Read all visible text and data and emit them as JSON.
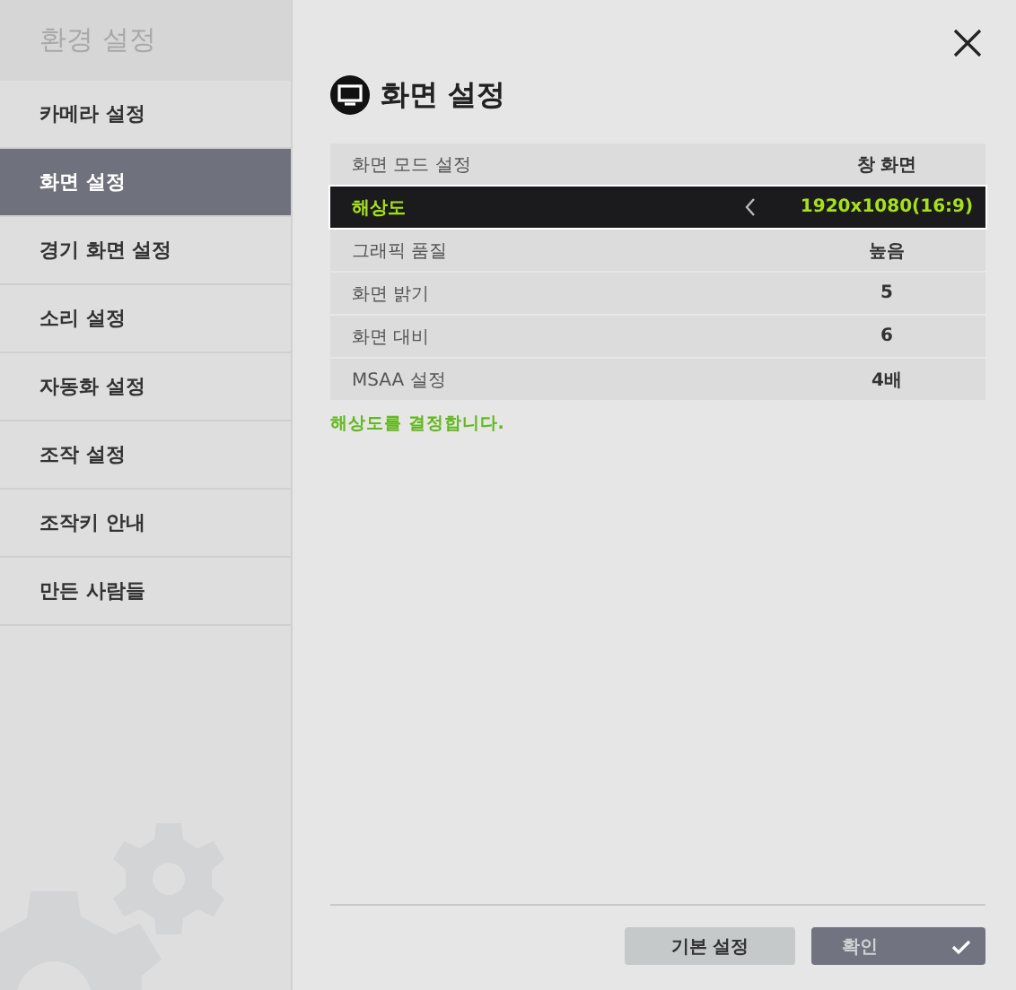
{
  "sidebar": {
    "title": "환경 설정",
    "items": [
      {
        "label": "카메라 설정",
        "selected": false
      },
      {
        "label": "화면 설정",
        "selected": true
      },
      {
        "label": "경기 화면 설정",
        "selected": false
      },
      {
        "label": "소리 설정",
        "selected": false
      },
      {
        "label": "자동화 설정",
        "selected": false
      },
      {
        "label": "조작 설정",
        "selected": false
      },
      {
        "label": "조작키 안내",
        "selected": false
      },
      {
        "label": "만든 사람들",
        "selected": false
      }
    ]
  },
  "panel": {
    "title": "화면 설정",
    "rows": [
      {
        "label": "화면 모드 설정",
        "value": "창 화면",
        "selected": false
      },
      {
        "label": "해상도",
        "value": "1920x1080(16:9)",
        "selected": true
      },
      {
        "label": "그래픽 품질",
        "value": "높음",
        "selected": false
      },
      {
        "label": "화면 밝기",
        "value": "5",
        "selected": false
      },
      {
        "label": "화면 대비",
        "value": "6",
        "selected": false
      },
      {
        "label": "MSAA 설정",
        "value": "4배",
        "selected": false
      }
    ],
    "hint": "해상도를 결정합니다."
  },
  "buttons": [
    {
      "label": "기본 설정",
      "kind": "secondary"
    },
    {
      "label": "확인",
      "kind": "primary"
    }
  ]
}
